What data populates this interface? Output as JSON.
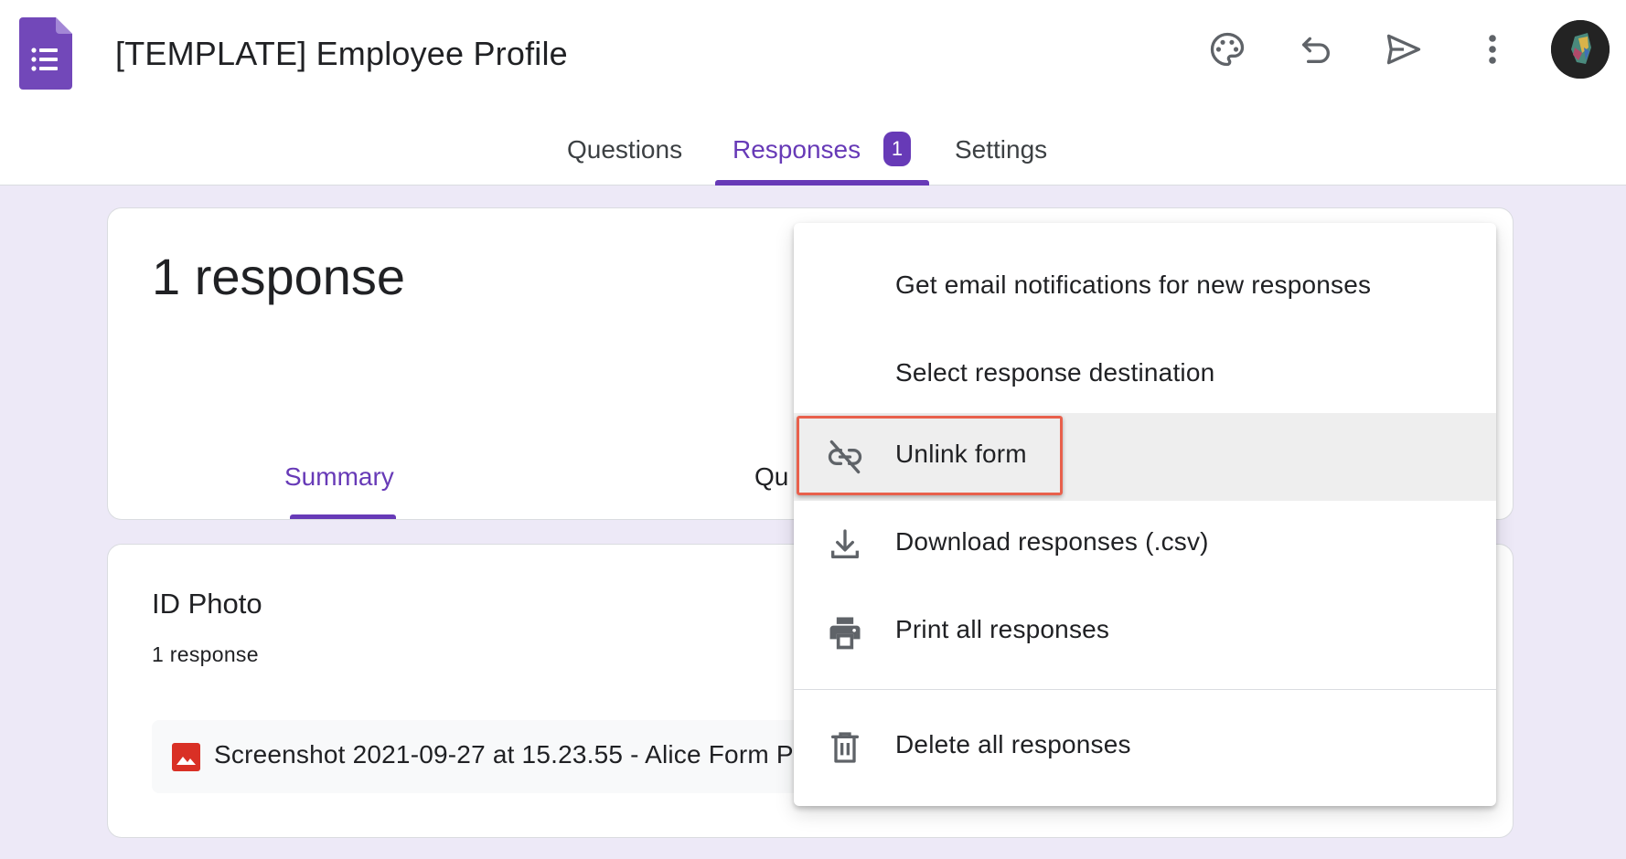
{
  "app": {
    "title": "[TEMPLATE] Employee Profile",
    "accent_color": "#673ab7",
    "header_icons": [
      "palette-icon",
      "undo-icon",
      "send-icon",
      "more-vert-icon"
    ]
  },
  "tabs": [
    {
      "label": "Questions",
      "active": false
    },
    {
      "label": "Responses",
      "active": true,
      "badge": "1"
    },
    {
      "label": "Settings",
      "active": false
    }
  ],
  "summary_card": {
    "response_count": "1 response",
    "subtabs": [
      {
        "label": "Summary",
        "active": true
      },
      {
        "label": "Qu",
        "active": false
      }
    ]
  },
  "question_card": {
    "title": "ID Photo",
    "count": "1 response",
    "file": {
      "icon": "image-file-icon",
      "name": "Screenshot 2021-09-27 at 15.23.55 - Alice Form P"
    }
  },
  "menu": {
    "items": [
      {
        "label": "Get email notifications for new responses",
        "icon": ""
      },
      {
        "label": "Select response destination",
        "icon": ""
      },
      {
        "label": "Unlink form",
        "icon": "unlink-icon",
        "highlighted": true
      },
      {
        "label": "Download responses (.csv)",
        "icon": "download-icon"
      },
      {
        "label": "Print all responses",
        "icon": "print-icon"
      },
      {
        "label": "Delete all responses",
        "icon": "trash-icon"
      }
    ],
    "highlight_color": "#e8604c"
  }
}
